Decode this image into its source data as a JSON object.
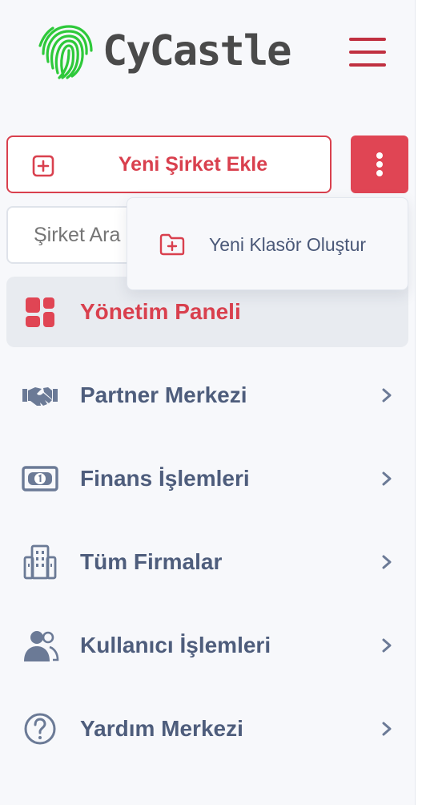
{
  "brand": {
    "name": "CyCastle"
  },
  "colors": {
    "accent": "#e04554",
    "text": "#4e5d7c",
    "muted": "#9aa7be"
  },
  "actions": {
    "new_company_label": "Yeni Şirket Ekle",
    "more_icon": "vertical-dots-icon"
  },
  "search": {
    "placeholder": "Şirket Ara"
  },
  "dropdown": {
    "items": [
      {
        "label": "Yeni Klasör Oluştur",
        "icon": "folder-plus-icon"
      }
    ]
  },
  "nav": {
    "items": [
      {
        "label": "Yönetim Paneli",
        "icon": "dashboard-grid-icon",
        "active": true
      },
      {
        "label": "Partner Merkezi",
        "icon": "handshake-icon"
      },
      {
        "label": "Finans İşlemleri",
        "icon": "money-bill-icon"
      },
      {
        "label": "Tüm Firmalar",
        "icon": "building-icon"
      },
      {
        "label": "Kullanıcı İşlemleri",
        "icon": "users-icon"
      },
      {
        "label": "Yardım Merkezi",
        "icon": "question-circle-icon"
      }
    ]
  }
}
